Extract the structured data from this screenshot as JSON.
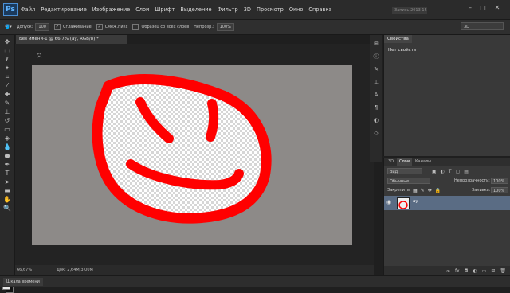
{
  "app": {
    "logo": "Ps"
  },
  "menu": [
    "Файл",
    "Редактирование",
    "Изображение",
    "Слои",
    "Шрифт",
    "Выделение",
    "Фильтр",
    "3D",
    "Просмотр",
    "Окно",
    "Справка"
  ],
  "workspace_field": "Запись 2013 15",
  "options": {
    "tolerance_label": "Допуск:",
    "tolerance_value": "100",
    "antialias": "Сглаживание",
    "contiguous": "Смеж.пикс",
    "all_layers": "Образец со всех слоев",
    "opacity_label": "Непрозр.:",
    "opacity_value": "100%",
    "workspace": "3D"
  },
  "document": {
    "tab_title": "Без имени-1 @ 66,7% (ау, RGB/8) *",
    "zoom": "66,67%",
    "doc_info": "Док: 2,64M/3,00M"
  },
  "timeline_label": "Шкала времени",
  "properties": {
    "tab": "Свойства",
    "empty_text": "Нет свойств"
  },
  "layers": {
    "tabs": [
      "3D",
      "Слои",
      "Каналы"
    ],
    "filter_kind": "Вид",
    "blend_mode": "Обычные",
    "opacity_label": "Непрозрачность:",
    "opacity_value": "100%",
    "lock_label": "Закрепить:",
    "fill_label": "Заливка:",
    "fill_value": "100%",
    "items": [
      {
        "name": "ау"
      }
    ]
  },
  "colors": {
    "stroke": "#ff0000",
    "canvas_bg": "#8d8a88",
    "selected_layer": "#5a6c84"
  }
}
